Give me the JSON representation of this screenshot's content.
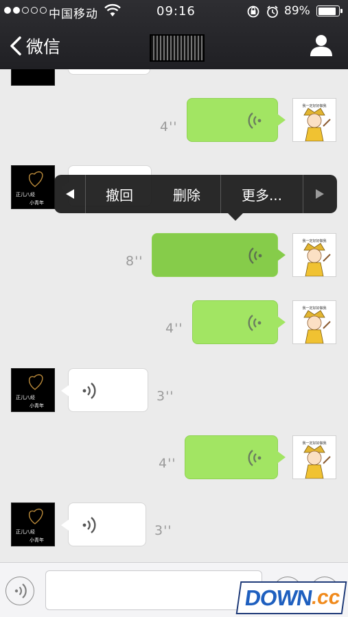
{
  "status_bar": {
    "signal_dots": [
      true,
      true,
      false,
      false,
      false
    ],
    "carrier": "中国移动",
    "time": "09:16",
    "battery_text": "89%",
    "battery_level": 0.89
  },
  "nav": {
    "back_label": "微信",
    "title": ""
  },
  "messages": [
    {
      "side": "in",
      "duration": ""
    },
    {
      "side": "out",
      "duration": "4''"
    },
    {
      "side": "in",
      "duration": ""
    },
    {
      "side": "out",
      "duration": "8''",
      "pressed": true
    },
    {
      "side": "out",
      "duration": "4''"
    },
    {
      "side": "in",
      "duration": "3''"
    },
    {
      "side": "out",
      "duration": "4''"
    },
    {
      "side": "in",
      "duration": "3''"
    }
  ],
  "avatars": {
    "female_text_line1": "正儿八经",
    "female_text_line2": "小青年",
    "male_caption": "我一定好好做我"
  },
  "context_menu": {
    "items": [
      "撤回",
      "删除",
      "更多..."
    ]
  },
  "input": {
    "value": "",
    "placeholder": ""
  },
  "watermark": {
    "main": "DOWN",
    "dot": ".",
    "suffix": "cc"
  },
  "colors": {
    "bubble_out": "#a2e563",
    "bubble_in": "#ffffff",
    "nav_bg": "#2a2a2e"
  }
}
